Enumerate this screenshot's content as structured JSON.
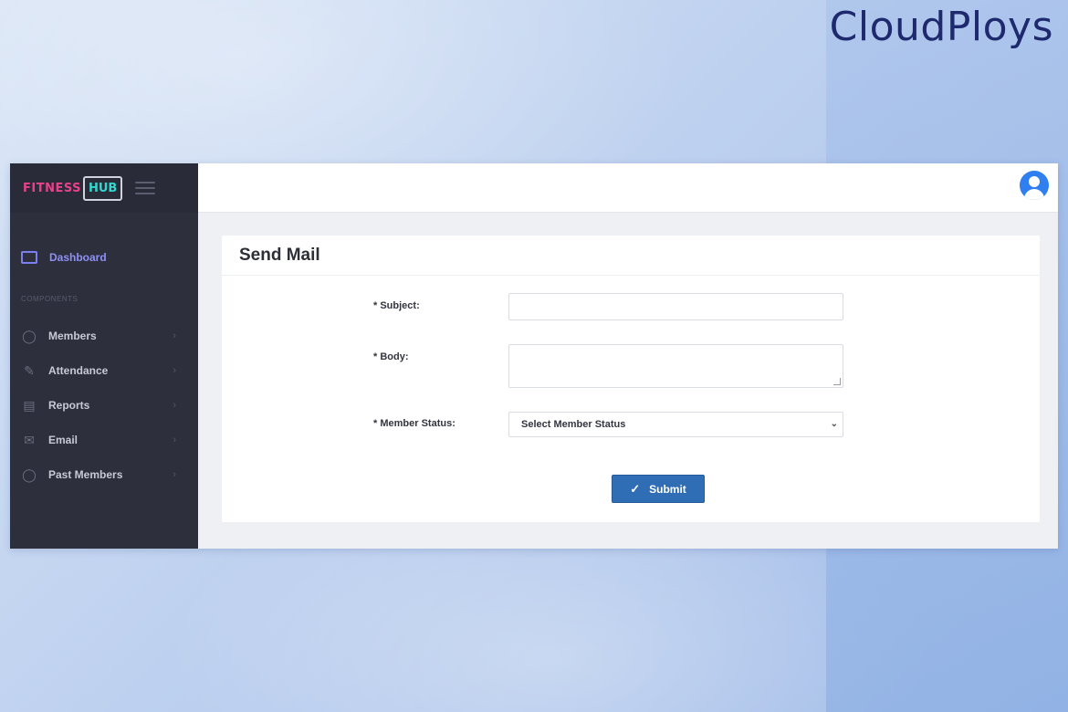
{
  "brand": "CloudPloys",
  "sidebar": {
    "logo_left": "FITNESS",
    "logo_right": "HUB",
    "dashboard": "Dashboard",
    "section": "COMPONENTS",
    "items": [
      {
        "label": "Members",
        "icon": "user-icon"
      },
      {
        "label": "Attendance",
        "icon": "pencil-icon"
      },
      {
        "label": "Reports",
        "icon": "document-icon"
      },
      {
        "label": "Email",
        "icon": "mail-icon"
      },
      {
        "label": "Past Members",
        "icon": "user-icon"
      }
    ]
  },
  "form": {
    "title": "Send Mail",
    "subject_label": "* Subject:",
    "subject_value": "",
    "body_label": "* Body:",
    "body_value": "",
    "status_label": "* Member Status:",
    "status_selected": "Select Member Status",
    "submit_label": "Submit"
  },
  "colors": {
    "sidebar_bg": "#2e2f3d",
    "accent": "#2f6db5",
    "dashboard_active": "#8d90f5",
    "brand": "#1f2a6e"
  }
}
